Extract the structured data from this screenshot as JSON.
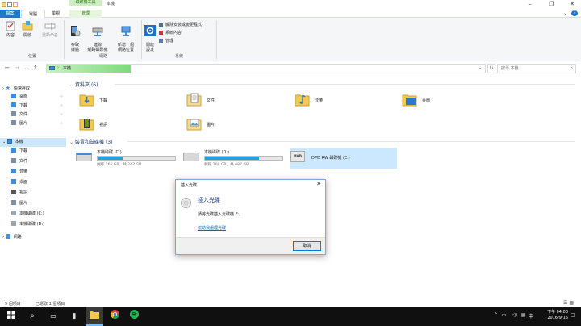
{
  "titlebar": {
    "context_tab": "磁碟機工具",
    "title": "本機"
  },
  "ribbon": {
    "tabs": [
      "檔案",
      "電腦",
      "檢視",
      "管理"
    ],
    "location": {
      "label": "位置",
      "properties": "內容",
      "open": "開啟",
      "rename": "重新命名"
    },
    "network": {
      "label": "網路",
      "access_media": "存取\n媒體",
      "map_drive": "連線\n網路磁碟機",
      "add_location": "新增一個\n網路位置"
    },
    "system": {
      "label": "系統",
      "open_settings": "開啟\n設定",
      "uninstall": "解除安裝或變更程式",
      "system_properties": "系統內容",
      "manage": "管理"
    }
  },
  "address": {
    "path": "本機",
    "search_placeholder": "搜尋 本機"
  },
  "nav": {
    "quick_access": "快速存取",
    "items": [
      {
        "label": "桌面",
        "color": "#3c8dde"
      },
      {
        "label": "下載",
        "color": "#3c8dde"
      },
      {
        "label": "文件",
        "color": "#7a8ea8"
      },
      {
        "label": "圖片",
        "color": "#7a8ea8"
      }
    ],
    "this_pc": "本機",
    "pc_items": [
      {
        "label": "下載",
        "color": "#3c8dde"
      },
      {
        "label": "文件",
        "color": "#7a8ea8"
      },
      {
        "label": "音樂",
        "color": "#3c8dde"
      },
      {
        "label": "桌面",
        "color": "#3c8dde"
      },
      {
        "label": "視訊",
        "color": "#555555"
      },
      {
        "label": "圖片",
        "color": "#7a8ea8"
      },
      {
        "label": "本機磁碟 (C:)",
        "color": "#9aa6b2"
      },
      {
        "label": "本機磁碟 (D:)",
        "color": "#9aa6b2"
      }
    ],
    "network": "網路"
  },
  "content": {
    "folders_title": "資料夾 (6)",
    "folders": [
      "下載",
      "文件",
      "音樂",
      "桌面",
      "視訊",
      "圖片"
    ],
    "drives_title": "裝置和磁碟機 (3)",
    "drives": [
      {
        "name": "本機磁碟 (C:)",
        "free": "剩餘 165 GB，共 242 GB",
        "used_fraction": 0.32
      },
      {
        "name": "本機磁碟 (D:)",
        "free": "剩餘 209 GB，共 687 GB",
        "used_fraction": 0.7
      },
      {
        "name": "DVD RW 磁碟機 (E:)"
      }
    ]
  },
  "dialog": {
    "title": "插入光碟",
    "heading": "插入光碟",
    "message": "請將光碟插入光碟機 E:。",
    "link": "協助我處理光碟",
    "cancel": "取消"
  },
  "status": {
    "items": "9 個項目",
    "selected": "已選取 1 個項目"
  },
  "taskbar": {
    "time": "下午 04:03",
    "date": "2016/9/15"
  }
}
